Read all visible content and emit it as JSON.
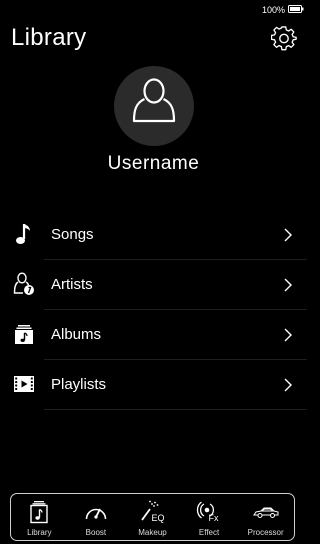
{
  "status_bar": {
    "battery": "100%"
  },
  "header": {
    "title": "Library"
  },
  "profile": {
    "username": "Username"
  },
  "menu": {
    "items": [
      {
        "label": "Songs",
        "icon": "music-note-icon"
      },
      {
        "label": "Artists",
        "icon": "artist-icon"
      },
      {
        "label": "Albums",
        "icon": "album-icon"
      },
      {
        "label": "Playlists",
        "icon": "playlist-icon"
      }
    ]
  },
  "tabs": [
    {
      "label": "Library",
      "icon": "library-icon",
      "active": true
    },
    {
      "label": "Boost",
      "icon": "speedometer-icon"
    },
    {
      "label": "Makeup",
      "icon": "eq-wand-icon"
    },
    {
      "label": "Effect",
      "icon": "fx-icon"
    },
    {
      "label": "Processor",
      "icon": "car-icon"
    }
  ],
  "colors": {
    "background": "#000000",
    "text": "#ffffff",
    "divider": "#1e1e1e",
    "avatar_bg": "#2b2b2b",
    "tab_border": "#cfcfcf"
  }
}
